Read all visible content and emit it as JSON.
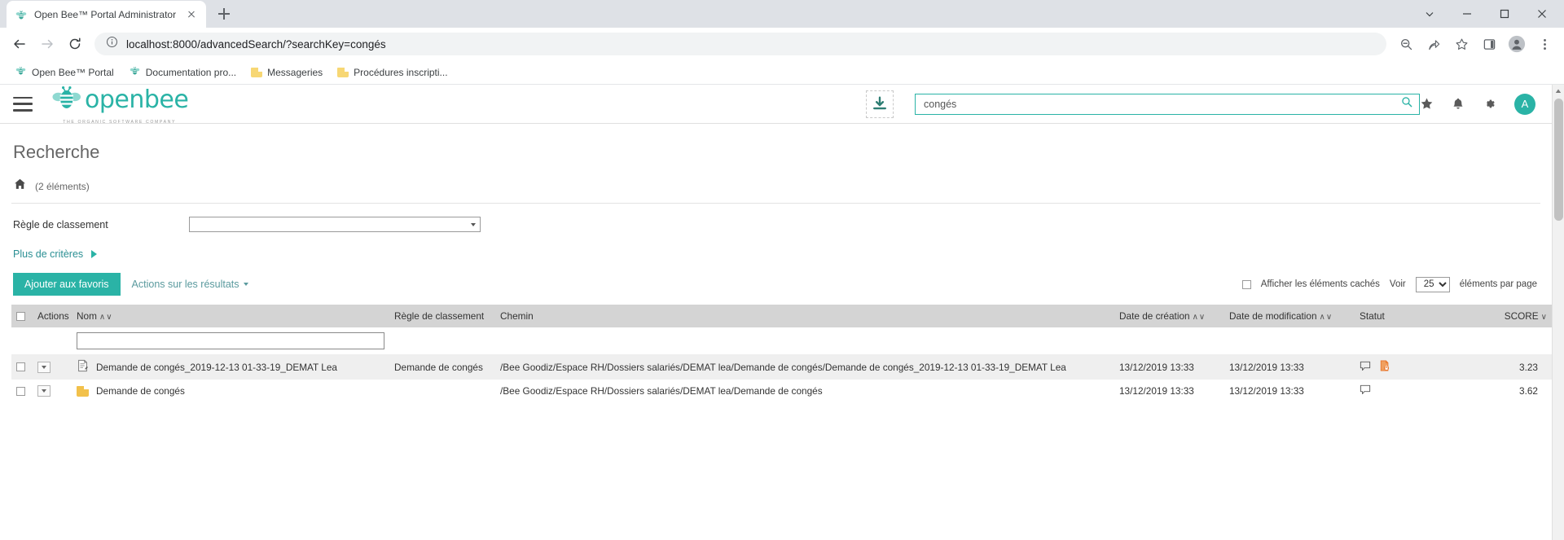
{
  "browser": {
    "tab": {
      "title": "Open Bee™ Portal Administrator",
      "favicon": "bee-icon"
    },
    "new_tab_label": "+",
    "nav": {
      "back": "back-arrow-icon",
      "forward": "forward-arrow-icon",
      "reload": "reload-icon",
      "info": "info-circle-icon",
      "url_scheme": "localhost:8000",
      "url_path": "/advancedSearch/?searchKey=congés",
      "url_full": "localhost:8000/advancedSearch/?searchKey=congés"
    },
    "toolbar_icons": [
      "zoom-out-icon",
      "share-icon",
      "bookmark-star-icon",
      "sidepanel-icon",
      "profile-icon",
      "more-menu-icon"
    ],
    "window_controls": [
      "minimize-chevron-icon",
      "minimize-icon",
      "maximize-icon",
      "close-icon"
    ],
    "bookmarks": [
      {
        "label": "Open Bee™ Portal",
        "icon": "bee-icon"
      },
      {
        "label": "Documentation pro...",
        "icon": "bee-icon"
      },
      {
        "label": "Messageries",
        "icon": "folder-icon"
      },
      {
        "label": "Procédures inscripti...",
        "icon": "folder-icon"
      }
    ]
  },
  "app": {
    "menu_icon": "hamburger-menu-icon",
    "logo_text": "openbee",
    "logo_tagline": "THE ORGANIC SOFTWARE COMPANY",
    "download_icon": "download-icon",
    "search": {
      "value": "congés",
      "placeholder": "",
      "icon": "search-icon"
    },
    "header_icons": [
      {
        "name": "favorites-star-icon"
      },
      {
        "name": "notifications-bell-icon"
      },
      {
        "name": "settings-gear-icon"
      }
    ],
    "avatar_initial": "A"
  },
  "page": {
    "title": "Recherche",
    "home_icon": "home-icon",
    "element_count": "(2 éléments)",
    "criteria_label": "Règle de classement",
    "criteria_value": "",
    "more_criteria_label": "Plus de critères",
    "add_favorites_label": "Ajouter aux favoris",
    "results_actions_label": "Actions sur les résultats",
    "show_hidden_label": "Afficher les éléments cachés",
    "see_label": "Voir",
    "per_page_value": "25",
    "per_page_suffix": "éléments par page",
    "name_filter_value": ""
  },
  "table": {
    "columns": [
      {
        "key": "check",
        "label": ""
      },
      {
        "key": "actions",
        "label": "Actions"
      },
      {
        "key": "nom",
        "label": "Nom",
        "sort": "∧∨"
      },
      {
        "key": "regle",
        "label": "Règle de classement"
      },
      {
        "key": "chemin",
        "label": "Chemin"
      },
      {
        "key": "creation",
        "label": "Date de création",
        "sort": "∧∨"
      },
      {
        "key": "modification",
        "label": "Date de modification",
        "sort": "∧∨"
      },
      {
        "key": "statut",
        "label": "Statut"
      },
      {
        "key": "score",
        "label": "SCORE",
        "sort": "∨"
      }
    ],
    "rows": [
      {
        "icon": "document-icon",
        "nom": "Demande de congés_2019-12-13 01-33-19_DEMAT Lea",
        "regle": "Demande de congés",
        "chemin": "/Bee Goodiz/Espace RH/Dossiers salariés/DEMAT lea/Demande de congés/Demande de congés_2019-12-13 01-33-19_DEMAT Lea",
        "creation": "13/12/2019 13:33",
        "modification": "13/12/2019 13:33",
        "statut_icons": [
          "comment-icon",
          "locked-document-icon"
        ],
        "score": "3.23"
      },
      {
        "icon": "folder-icon",
        "nom": "Demande de congés",
        "regle": "",
        "chemin": "/Bee Goodiz/Espace RH/Dossiers salariés/DEMAT lea/Demande de congés",
        "creation": "13/12/2019 13:33",
        "modification": "13/12/2019 13:33",
        "statut_icons": [
          "comment-icon"
        ],
        "score": "3.62"
      }
    ]
  },
  "colors": {
    "brand": "#2ab3a6",
    "link": "#5a9a9e",
    "header_row": "#d4d4d4",
    "alt_row": "#efefef",
    "folder": "#f2c14b",
    "lock": "#e8762c"
  }
}
